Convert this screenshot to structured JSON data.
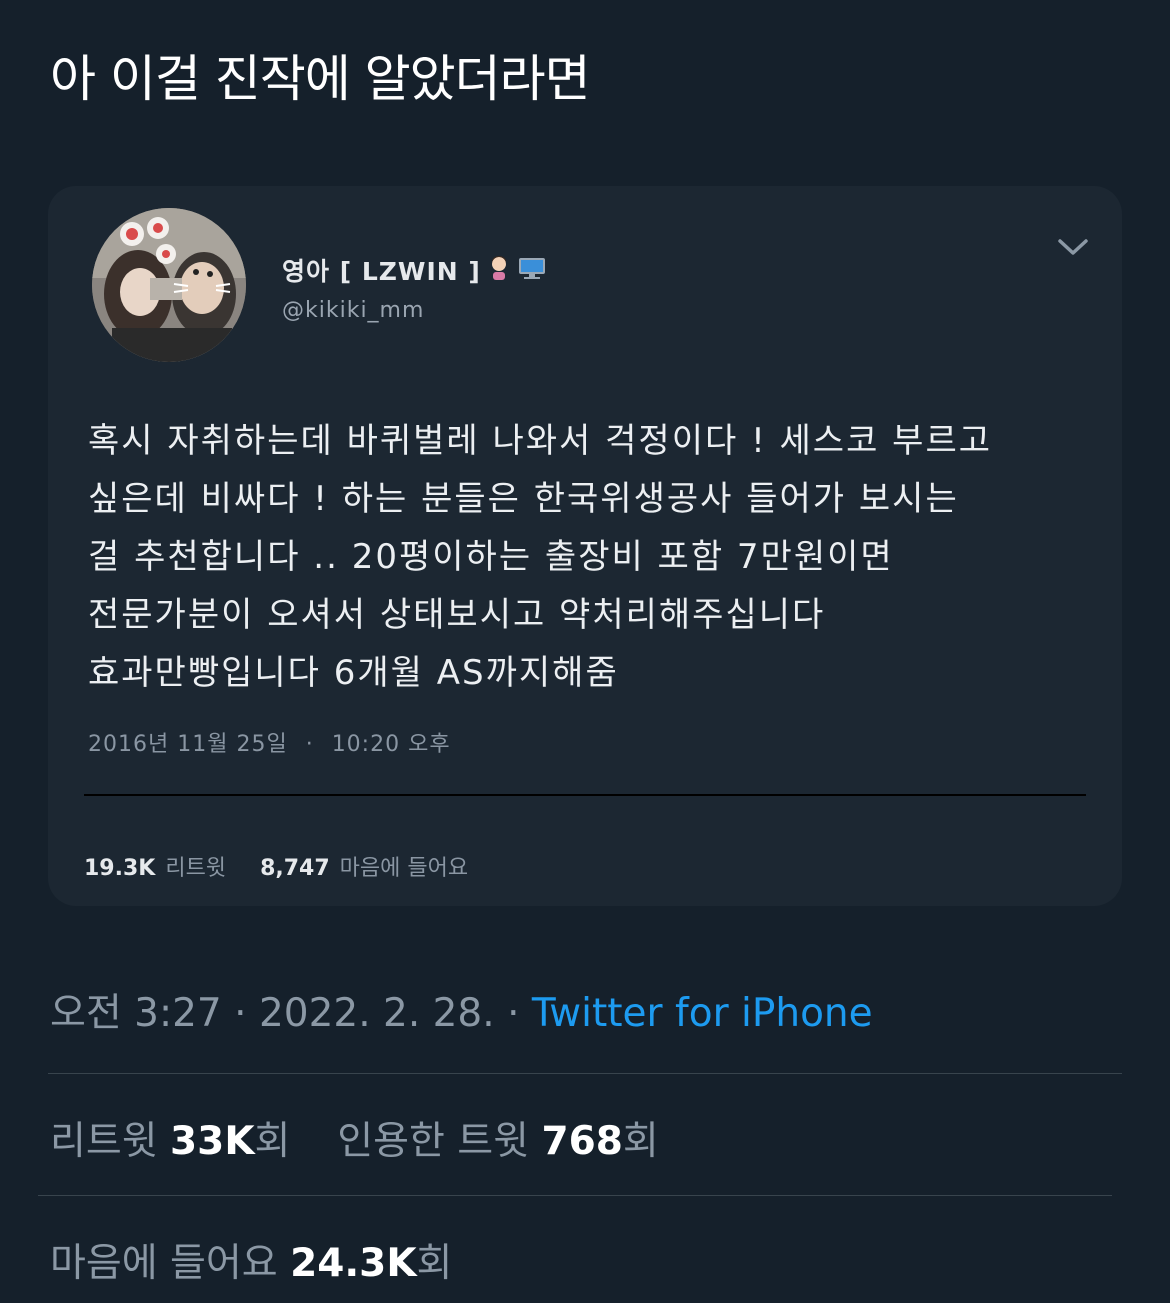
{
  "tweet": {
    "text": "아 이걸 진작에 알았더라면",
    "time": "오전 3:27",
    "separator": "·",
    "date": "2022. 2. 28.",
    "source": "Twitter for iPhone"
  },
  "quoted": {
    "display_name": "영아 [ LZWIN ]",
    "handle": "@kikiki_mm",
    "lines": [
      "혹시 자취하는데 바퀴벌레 나와서 걱정이다 ! 세스코 부르고",
      "싶은데 비싸다 ! 하는 분들은 한국위생공사 들어가 보시는",
      "걸 추천합니다 ..  20평이하는 출장비 포함 7만원이면",
      "전문가분이 오셔서 상태보시고 약처리해주십니다",
      "효과만빵입니다 6개월 AS까지해줌"
    ],
    "date": "2016년 11월 25일",
    "date_separator": "·",
    "time": "10:20 오후",
    "retweets_count": "19.3K",
    "retweets_label": "리트윗",
    "likes_count": "8,747",
    "likes_label": "마음에 들어요"
  },
  "stats": {
    "retweets_label": "리트윗",
    "retweets_count": "33K",
    "retweets_unit": "회",
    "quotes_label": "인용한 트윗",
    "quotes_count": "768",
    "quotes_unit": "회",
    "likes_label": "마음에 들어요",
    "likes_count": "24.3K",
    "likes_unit": "회"
  },
  "colors": {
    "background": "#15202b",
    "card": "#1c2732",
    "link": "#1d9bf0",
    "secondary_text": "#8b98a5"
  },
  "icons": {
    "chevron": "chevron-down-icon",
    "emoji_1": "woman-emoji",
    "emoji_2": "computer-emoji"
  }
}
